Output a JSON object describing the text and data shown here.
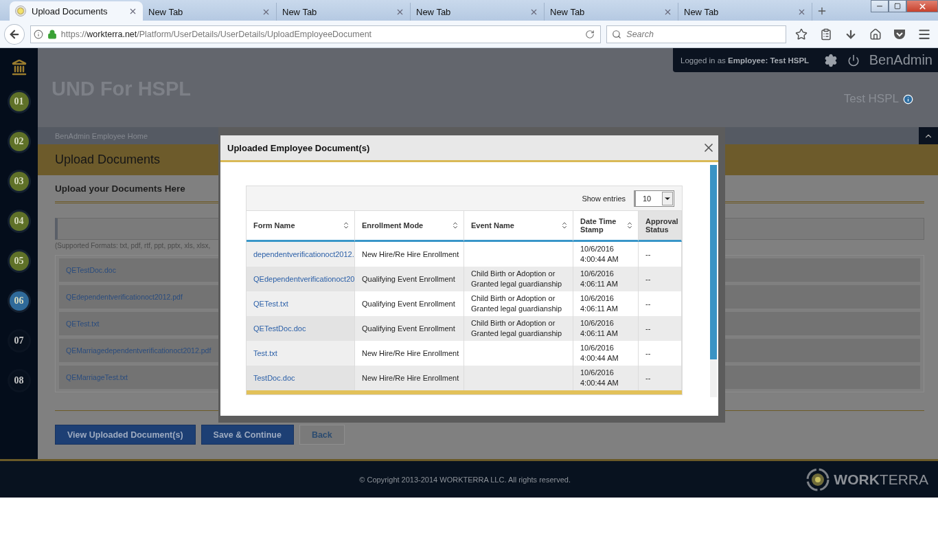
{
  "browser": {
    "tabs": [
      {
        "label": "Upload Documents",
        "selected": true
      },
      {
        "label": "New Tab",
        "selected": false
      },
      {
        "label": "New Tab",
        "selected": false
      },
      {
        "label": "New Tab",
        "selected": false
      },
      {
        "label": "New Tab",
        "selected": false
      },
      {
        "label": "New Tab",
        "selected": false
      }
    ],
    "url": {
      "scheme": "https://",
      "host": "workterra.net",
      "path": "/Platform/UserDetails/UserDetails/UploadEmployeeDocument"
    },
    "search_placeholder": "Search"
  },
  "sidebar": {
    "steps": [
      {
        "label": "01",
        "done": true,
        "selected": false
      },
      {
        "label": "02",
        "done": true,
        "selected": false
      },
      {
        "label": "03",
        "done": true,
        "selected": false
      },
      {
        "label": "04",
        "done": true,
        "selected": false
      },
      {
        "label": "05",
        "done": true,
        "selected": false
      },
      {
        "label": "06",
        "done": false,
        "selected": true
      },
      {
        "label": "07",
        "done": false,
        "selected": false
      },
      {
        "label": "08",
        "done": false,
        "selected": false
      }
    ]
  },
  "login_bar": {
    "text": "Logged in as **Employee:  Test HSPL**",
    "brand": "BenAdmin"
  },
  "header": {
    "company": "UND For HSPL",
    "user": "Test HSPL"
  },
  "breadcrumb": "BenAdmin Employee Home",
  "page_title": "Upload Documents",
  "section_title": "Upload your Documents Here",
  "formats_note": "(Supported Formats: txt, pdf, rtf, ppt, pptx, xls, xlsx,",
  "files": [
    "QETestDoc.doc",
    "QEdependentverificationoct2012.pdf",
    "QETest.txt",
    "QEMarriagedependentverificationoct2012.pdf",
    "QEMarriageTest.txt"
  ],
  "buttons": [
    {
      "label": "View Uploaded Document(s)",
      "kind": "primary"
    },
    {
      "label": "Save & Continue",
      "kind": "primary"
    },
    {
      "label": "Back",
      "kind": "secondary"
    }
  ],
  "footer": {
    "copyright": "© Copyright 2013-2014 WORKTERRA LLC. All rights reserved.",
    "logo_bold": "WORK",
    "logo_light": "TERRA"
  },
  "dialog": {
    "title": "Uploaded Employee Document(s)",
    "show_entries_label": "Show entries",
    "page_size": "10",
    "columns": [
      {
        "label": "Form Name",
        "sortable": true
      },
      {
        "label": "Enrollment Mode",
        "sortable": true
      },
      {
        "label": "Event Name",
        "sortable": true
      },
      {
        "label": "Date Time Stamp",
        "sortable": true
      },
      {
        "label": "Approval Status",
        "sortable": false
      }
    ],
    "rows": [
      [
        "dependentverificationoct2012.",
        "New Hire/Re Hire Enrollment",
        "",
        "10/6/2016 4:00:44 AM",
        "--"
      ],
      [
        "QEdependentverificationoct20",
        "Qualifying Event Enrollment",
        "Child Birth or Adoption or Granted legal guardianship",
        "10/6/2016 4:06:11 AM",
        "--"
      ],
      [
        "QETest.txt",
        "Qualifying Event Enrollment",
        "Child Birth or Adoption or Granted legal guardianship",
        "10/6/2016 4:06:11 AM",
        "--"
      ],
      [
        "QETestDoc.doc",
        "Qualifying Event Enrollment",
        "Child Birth or Adoption or Granted legal guardianship",
        "10/6/2016 4:06:11 AM",
        "--"
      ],
      [
        "Test.txt",
        "New Hire/Re Hire Enrollment",
        "",
        "10/6/2016 4:00:44 AM",
        "--"
      ],
      [
        "TestDoc.doc",
        "New Hire/Re Hire Enrollment",
        "",
        "10/6/2016 4:00:44 AM",
        "--"
      ]
    ]
  }
}
